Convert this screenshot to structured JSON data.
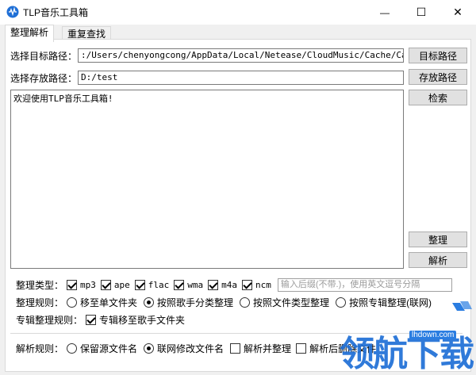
{
  "window": {
    "title": "TLP音乐工具箱",
    "minimize_symbol": "—",
    "maximize_symbol": "☐",
    "close_symbol": "✕"
  },
  "tabs": [
    {
      "label": "整理解析",
      "active": true
    },
    {
      "label": "重复查找",
      "active": false
    }
  ],
  "paths": {
    "target_label": "选择目标路径：",
    "target_value": ":/Users/chenyongcong/AppData/Local/Netease/CloudMusic/Cache/Cache",
    "target_button": "目标路径",
    "store_label": "选择存放路径：",
    "store_value": "D:/test",
    "store_button": "存放路径"
  },
  "log": {
    "text": "欢迎使用TLP音乐工具箱!"
  },
  "buttons": {
    "search": "检索",
    "organize": "整理",
    "parse": "解析"
  },
  "organize_type": {
    "label": "整理类型：",
    "options": [
      {
        "label": "mp3",
        "checked": true
      },
      {
        "label": "ape",
        "checked": true
      },
      {
        "label": "flac",
        "checked": true
      },
      {
        "label": "wma",
        "checked": true
      },
      {
        "label": "m4a",
        "checked": true
      },
      {
        "label": "ncm",
        "checked": true
      }
    ],
    "suffix_placeholder": "输入后缀(不带.)，使用英文逗号分隔"
  },
  "organize_rule": {
    "label": "整理规则：",
    "options": [
      {
        "label": "移至单文件夹",
        "checked": false
      },
      {
        "label": "按照歌手分类整理",
        "checked": true
      },
      {
        "label": "按照文件类型整理",
        "checked": false
      },
      {
        "label": "按照专辑整理(联网)",
        "checked": false
      }
    ]
  },
  "album_rule": {
    "label": "专辑整理规则：",
    "option": {
      "label": "专辑移至歌手文件夹",
      "checked": true
    }
  },
  "parse_rule": {
    "label": "解析规则：",
    "radios": [
      {
        "label": "保留源文件名",
        "checked": false
      },
      {
        "label": "联网修改文件名",
        "checked": true
      }
    ],
    "checks": [
      {
        "label": "解析并整理",
        "checked": false
      },
      {
        "label": "解析后删除文件",
        "checked": false
      }
    ]
  },
  "watermark": {
    "brand": "领航下载",
    "site": "lhdown.com"
  },
  "colors": {
    "accent": "#2a7de1",
    "watermark_blue": "#1f6fd6"
  }
}
